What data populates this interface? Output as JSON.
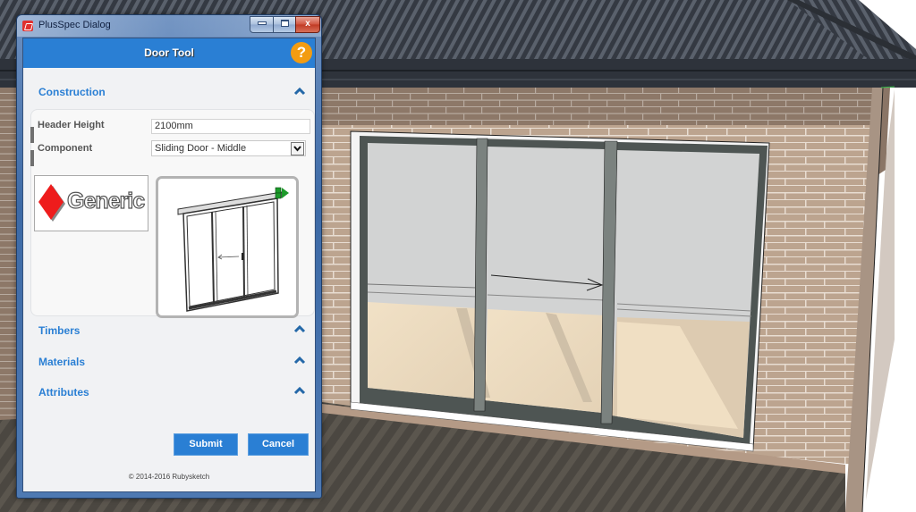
{
  "window": {
    "title": "PlusSpec Dialog",
    "controls": {
      "minimize": "–",
      "maximize": "□",
      "close": "x"
    }
  },
  "dialog": {
    "header_title": "Door Tool",
    "help_icon": "?",
    "sections": [
      {
        "label": "Construction",
        "expanded": true
      },
      {
        "label": "Timbers",
        "expanded": false
      },
      {
        "label": "Materials",
        "expanded": false
      },
      {
        "label": "Attributes",
        "expanded": false
      }
    ],
    "construction": {
      "header_height_label": "Header Height",
      "header_height_value": "2100mm",
      "component_label": "Component",
      "component_selected": "Sliding Door - Middle",
      "logo_text": "Generic",
      "preview_icon": "sliding-door-preview"
    },
    "buttons": {
      "submit": "Submit",
      "cancel": "Cancel"
    },
    "copyright": "© 2014-2016 Rubysketch"
  },
  "scene": {
    "description": "3D house model with sliding glass door",
    "colors": {
      "roof": "#3a3f47",
      "brick": "#b49a86",
      "brick_dark": "#8a7566",
      "frame": "#4a4f4c",
      "glass": "#d2d3d3",
      "floor_inside": "#eddcc0",
      "deck": "#4a4640",
      "sky": "#ffffff",
      "accent": "#2a7fd4"
    }
  }
}
